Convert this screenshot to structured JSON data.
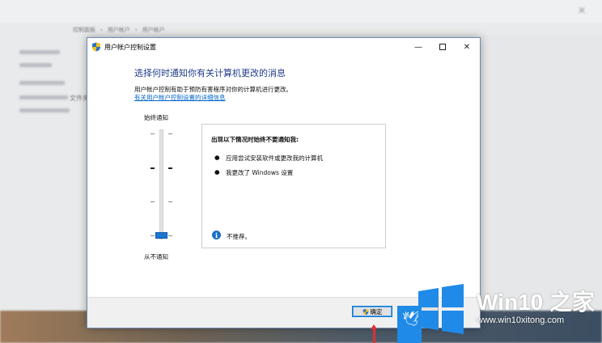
{
  "background": {
    "breadcrumb": [
      "控制面板",
      "用户帐户",
      "用户帐户"
    ],
    "side_text": "文件夹"
  },
  "dialog": {
    "title": "用户帐户控制设置",
    "heading": "选择何时通知你有关计算机更改的消息",
    "description": "用户帐户控制有助于预防有害程序对你的计算机进行更改。",
    "link": "有关用户帐户控制设置的详细信息",
    "slider": {
      "top_label": "始终通知",
      "bottom_label": "从不通知",
      "level": 0,
      "levels": 4
    },
    "panel": {
      "title": "出现以下情况时始终不要通知我:",
      "bullets": [
        "应用尝试安装软件或更改我的计算机",
        "我更改了 Windows 设置"
      ],
      "note": "不推荐。"
    },
    "ok_label": "确定",
    "cancel_label": ""
  },
  "watermark": {
    "title": "Win10 之家",
    "url": "www.win10xitong.com"
  },
  "colors": {
    "accent": "#1a76d2",
    "heading": "#1f3c88",
    "link": "#0066cc",
    "watermark_blue": "#1f8ae8"
  }
}
